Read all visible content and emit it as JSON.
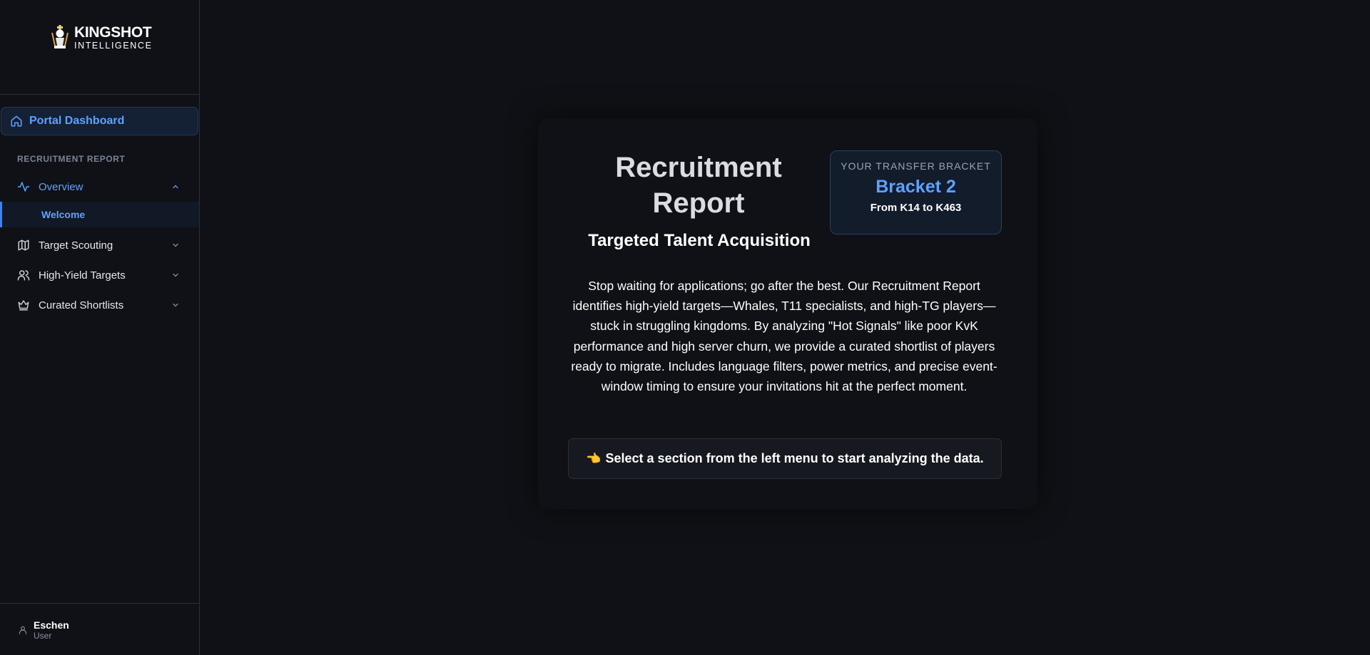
{
  "brand": {
    "title": "KINGSHOT",
    "subtitle": "INTELLIGENCE"
  },
  "sidebar": {
    "portal_label": "Portal Dashboard",
    "section_label": "RECRUITMENT REPORT",
    "items": [
      {
        "label": "Overview",
        "icon": "activity-icon",
        "expanded": true
      },
      {
        "label": "Target Scouting",
        "icon": "map-icon",
        "expanded": false
      },
      {
        "label": "High-Yield Targets",
        "icon": "users-icon",
        "expanded": false
      },
      {
        "label": "Curated Shortlists",
        "icon": "crown-icon",
        "expanded": false
      }
    ],
    "sub_item": "Welcome"
  },
  "user": {
    "name": "Eschen",
    "role": "User"
  },
  "main": {
    "title": "Recruitment Report",
    "subtitle": "Targeted Talent Acquisition",
    "bracket": {
      "label": "YOUR TRANSFER BRACKET",
      "value": "Bracket 2",
      "range": "From K14 to K463"
    },
    "description": "Stop waiting for applications; go after the best. Our Recruitment Report identifies high-yield targets—Whales, T11 specialists, and high-TG players—stuck in struggling kingdoms. By analyzing \"Hot Signals\" like poor KvK performance and high server churn, we provide a curated shortlist of players ready to migrate. Includes language filters, power metrics, and precise event-window timing to ensure your invitations hit at the perfect moment.",
    "cta_emoji": "👈",
    "cta": "Select a section from the left menu to start analyzing the data."
  },
  "colors": {
    "accent": "#5ea2ff",
    "background": "#0f1116",
    "border": "#2a2f38"
  }
}
